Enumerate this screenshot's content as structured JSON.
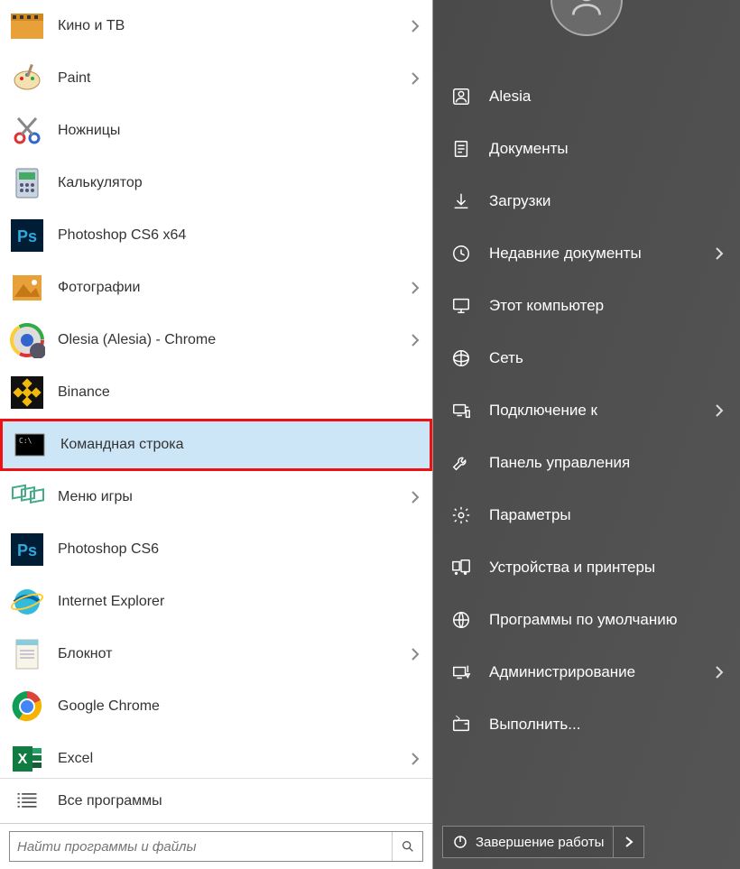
{
  "apps": [
    {
      "label": "Кино и ТВ",
      "icon": "movie",
      "hasSub": true
    },
    {
      "label": "Paint",
      "icon": "paint",
      "hasSub": true
    },
    {
      "label": "Ножницы",
      "icon": "scissors",
      "hasSub": false
    },
    {
      "label": "Калькулятор",
      "icon": "calc",
      "hasSub": false
    },
    {
      "label": "Photoshop CS6 x64",
      "icon": "ps",
      "hasSub": false
    },
    {
      "label": "Фотографии",
      "icon": "photos",
      "hasSub": true
    },
    {
      "label": "Olesia (Alesia) - Chrome",
      "icon": "chrome_user",
      "hasSub": true
    },
    {
      "label": "Binance",
      "icon": "binance",
      "hasSub": false
    },
    {
      "label": "Командная строка",
      "icon": "cmd",
      "hasSub": false,
      "highlight": true
    },
    {
      "label": "Меню игры",
      "icon": "gamebar",
      "hasSub": true
    },
    {
      "label": "Photoshop CS6",
      "icon": "ps",
      "hasSub": false
    },
    {
      "label": "Internet Explorer",
      "icon": "ie",
      "hasSub": false
    },
    {
      "label": "Блокнот",
      "icon": "notepad",
      "hasSub": true
    },
    {
      "label": "Google Chrome",
      "icon": "chrome",
      "hasSub": false
    },
    {
      "label": "Excel",
      "icon": "excel",
      "hasSub": true
    }
  ],
  "allPrograms": "Все программы",
  "searchPlaceholder": "Найти программы и файлы",
  "right": [
    {
      "label": "Alesia",
      "icon": "user",
      "hasSub": false
    },
    {
      "label": "Документы",
      "icon": "doc",
      "hasSub": false
    },
    {
      "label": "Загрузки",
      "icon": "download",
      "hasSub": false
    },
    {
      "label": "Недавние документы",
      "icon": "recent",
      "hasSub": true
    },
    {
      "label": "Этот компьютер",
      "icon": "pc",
      "hasSub": false
    },
    {
      "label": "Сеть",
      "icon": "network",
      "hasSub": false
    },
    {
      "label": "Подключение к",
      "icon": "connect",
      "hasSub": true
    },
    {
      "label": "Панель управления",
      "icon": "wrench",
      "hasSub": false
    },
    {
      "label": "Параметры",
      "icon": "gear",
      "hasSub": false
    },
    {
      "label": "Устройства и принтеры",
      "icon": "devices",
      "hasSub": false
    },
    {
      "label": "Программы по умолчанию",
      "icon": "globe",
      "hasSub": false
    },
    {
      "label": "Администрирование",
      "icon": "admin",
      "hasSub": true
    },
    {
      "label": "Выполнить...",
      "icon": "run",
      "hasSub": false
    }
  ],
  "shutdown": "Завершение работы"
}
